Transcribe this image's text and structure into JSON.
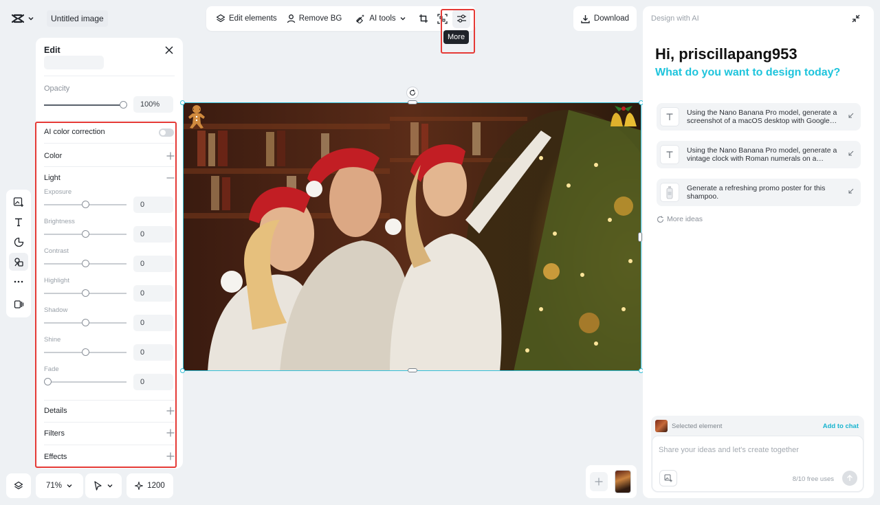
{
  "app": {
    "doc_title": "Untitled image"
  },
  "toolbar": {
    "edit_elements": "Edit elements",
    "remove_bg": "Remove BG",
    "ai_tools": "AI tools",
    "tooltip": "More",
    "download": "Download"
  },
  "edit": {
    "title": "Edit",
    "opacity_label": "Opacity",
    "opacity_value": "100%",
    "opacity_level": 1.0,
    "ai_color": "AI color correction",
    "ai_color_on": false,
    "color": "Color",
    "light": "Light",
    "adjust": [
      {
        "label": "Exposure",
        "value": "0",
        "level": 0.5
      },
      {
        "label": "Brightness",
        "value": "0",
        "level": 0.5
      },
      {
        "label": "Contrast",
        "value": "0",
        "level": 0.5
      },
      {
        "label": "Highlight",
        "value": "0",
        "level": 0.5
      },
      {
        "label": "Shadow",
        "value": "0",
        "level": 0.5
      },
      {
        "label": "Shine",
        "value": "0",
        "level": 0.5
      },
      {
        "label": "Fade",
        "value": "0",
        "level": 0.0
      }
    ],
    "details": "Details",
    "filters": "Filters",
    "effects": "Effects"
  },
  "bottom": {
    "zoom": "71%",
    "credits": "1200"
  },
  "ai_panel": {
    "header": "Design with AI",
    "greeting": "Hi, priscillapang953",
    "subtitle": "What do you want to design today?",
    "ideas": [
      {
        "text": "Using the Nano Banana Pro model, generate a screenshot of a macOS desktop with Google…",
        "icon": "text-icon"
      },
      {
        "text": "Using the Nano Banana Pro model, generate a vintage clock with Roman numerals on a…",
        "icon": "text-icon"
      },
      {
        "text": "Generate a refreshing promo poster for this shampoo.",
        "icon": "shampoo-thumbnail"
      }
    ],
    "more_ideas": "More ideas",
    "selected_element": "Selected element",
    "add_to_chat": "Add to chat",
    "chat_placeholder": "Share your ideas and let's create together",
    "free_uses": "8/10 free uses"
  },
  "colors": {
    "accent": "#1ec4dc",
    "highlight": "#e53935",
    "selection": "#31bfd8"
  }
}
